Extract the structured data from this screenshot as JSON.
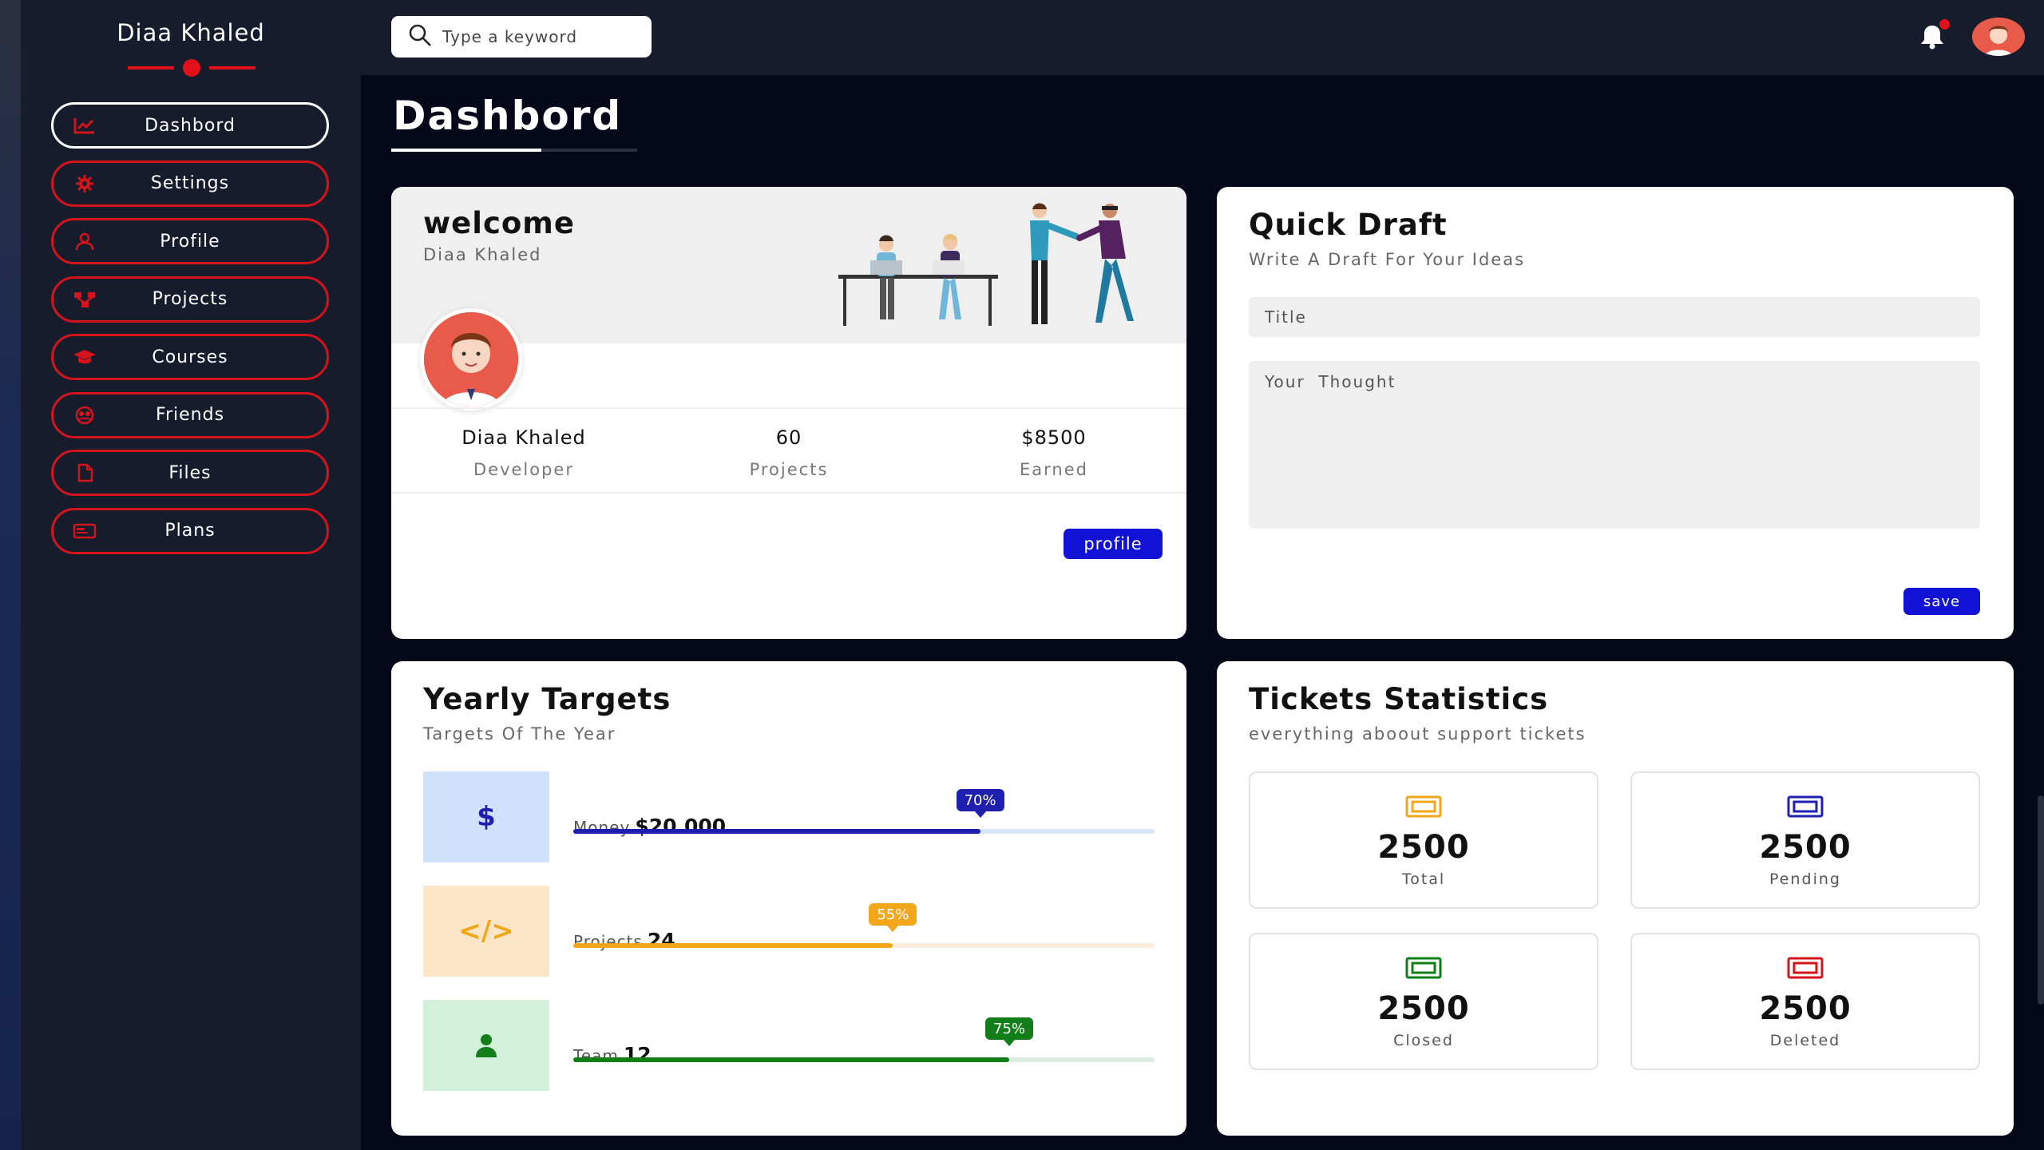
{
  "sidebar": {
    "brand": "Diaa Khaled",
    "items": [
      {
        "label": "Dashbord",
        "icon": "chart-icon",
        "active": true
      },
      {
        "label": "Settings",
        "icon": "gear-icon",
        "active": false
      },
      {
        "label": "Profile",
        "icon": "user-icon",
        "active": false
      },
      {
        "label": "Projects",
        "icon": "diagram-icon",
        "active": false
      },
      {
        "label": "Courses",
        "icon": "graduation-cap-icon",
        "active": false
      },
      {
        "label": "Friends",
        "icon": "friends-icon",
        "active": false
      },
      {
        "label": "Files",
        "icon": "file-icon",
        "active": false
      },
      {
        "label": "Plans",
        "icon": "credit-card-icon",
        "active": false
      }
    ]
  },
  "header": {
    "search_placeholder": "Type a keyword",
    "notification_icon": "bell-icon",
    "has_unread": true
  },
  "page": {
    "title": "Dashbord"
  },
  "welcome": {
    "title": "welcome",
    "name": "Diaa Khaled",
    "stats": [
      {
        "value": "Diaa Khaled",
        "label": "Developer"
      },
      {
        "value": "60",
        "label": "Projects"
      },
      {
        "value": "$8500",
        "label": "Earned"
      }
    ],
    "button": "profile"
  },
  "draft": {
    "title": "Quick Draft",
    "subtitle": "Write A Draft For Your Ideas",
    "title_placeholder": "Title",
    "thought_placeholder": "Your  Thought",
    "button": "save"
  },
  "targets": {
    "title": "Yearly Targets",
    "subtitle": "Targets Of The Year",
    "items": [
      {
        "label": "Money",
        "value": "$20.000",
        "percent": 70,
        "percent_label": "70%",
        "icon": "dollar-icon",
        "color": "#1f1faf",
        "bg": "#cfe2fb",
        "track": "#d6e6f8"
      },
      {
        "label": "Projects",
        "value": "24",
        "percent": 55,
        "percent_label": "55%",
        "icon": "code-icon",
        "color": "#f2a71b",
        "bg": "#fde6c8",
        "track": "#fbeedd"
      },
      {
        "label": "Team",
        "value": "12",
        "percent": 75,
        "percent_label": "75%",
        "icon": "user-icon",
        "color": "#127e1a",
        "bg": "#d3f0da",
        "track": "#dceee1"
      }
    ]
  },
  "tickets": {
    "title": "Tickets Statistics",
    "subtitle": "everything aboout support tickets",
    "items": [
      {
        "value": "2500",
        "label": "Total",
        "icon": "ticket-icon",
        "color": "#f2a71b"
      },
      {
        "value": "2500",
        "label": "Pending",
        "icon": "ticket-icon",
        "color": "#1f1faf"
      },
      {
        "value": "2500",
        "label": "Closed",
        "icon": "ticket-icon",
        "color": "#127e1a"
      },
      {
        "value": "2500",
        "label": "Deleted",
        "icon": "ticket-icon",
        "color": "#d4141c"
      }
    ]
  }
}
